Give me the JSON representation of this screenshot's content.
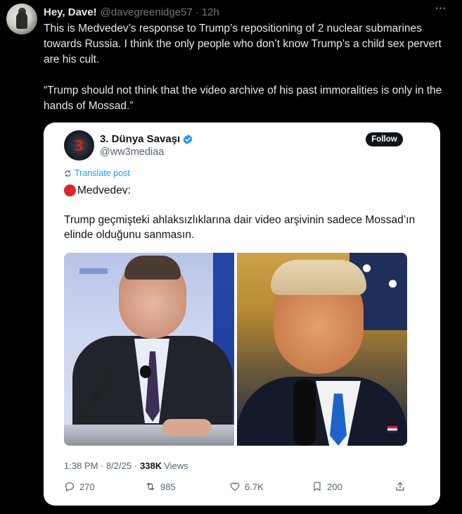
{
  "tweet": {
    "display_name": "Hey, Dave!",
    "handle": "@davegreenidge57",
    "separator": "·",
    "time": "12h",
    "more_label": "···",
    "text_p1": "This is Medvedev’s response to Trump’s repositioning of 2 nuclear submarines towards Russia. I think the only people who don’t know Trump’s a child sex pervert are his cult.",
    "text_p2": "“Trump should not think that the video archive of his past immoralities is only in the hands of Mossad.”"
  },
  "quote": {
    "avatar_text": "3",
    "display_name": "3. Dünya Savaşı",
    "handle": "@ww3mediaa",
    "follow_label": "Follow",
    "translate_label": "Translate post",
    "line1": "Medvedev:",
    "body": "Trump geçmişteki ahlaksızlıklarına dair video arşivinin sadece Mossad’ın elinde olduğunu sanmasın.",
    "meta_time": "1:38 PM · 8/2/25 ·",
    "views_count": "338K",
    "views_label": "Views",
    "actions": {
      "reply": "270",
      "retweet": "985",
      "like": "6.7K",
      "bookmark": "200"
    },
    "icons": {
      "reply": "reply-icon",
      "retweet": "retweet-icon",
      "like": "heart-icon",
      "bookmark": "bookmark-icon",
      "share": "share-icon",
      "verified": "verified-badge-icon",
      "status": "red-circle-icon"
    }
  },
  "colors": {
    "background": "#000000",
    "card": "#ffffff",
    "link_blue": "#1d9bf0",
    "muted": "#71767b",
    "text_light": "#e7e9ea",
    "text_dark": "#0f1419"
  }
}
